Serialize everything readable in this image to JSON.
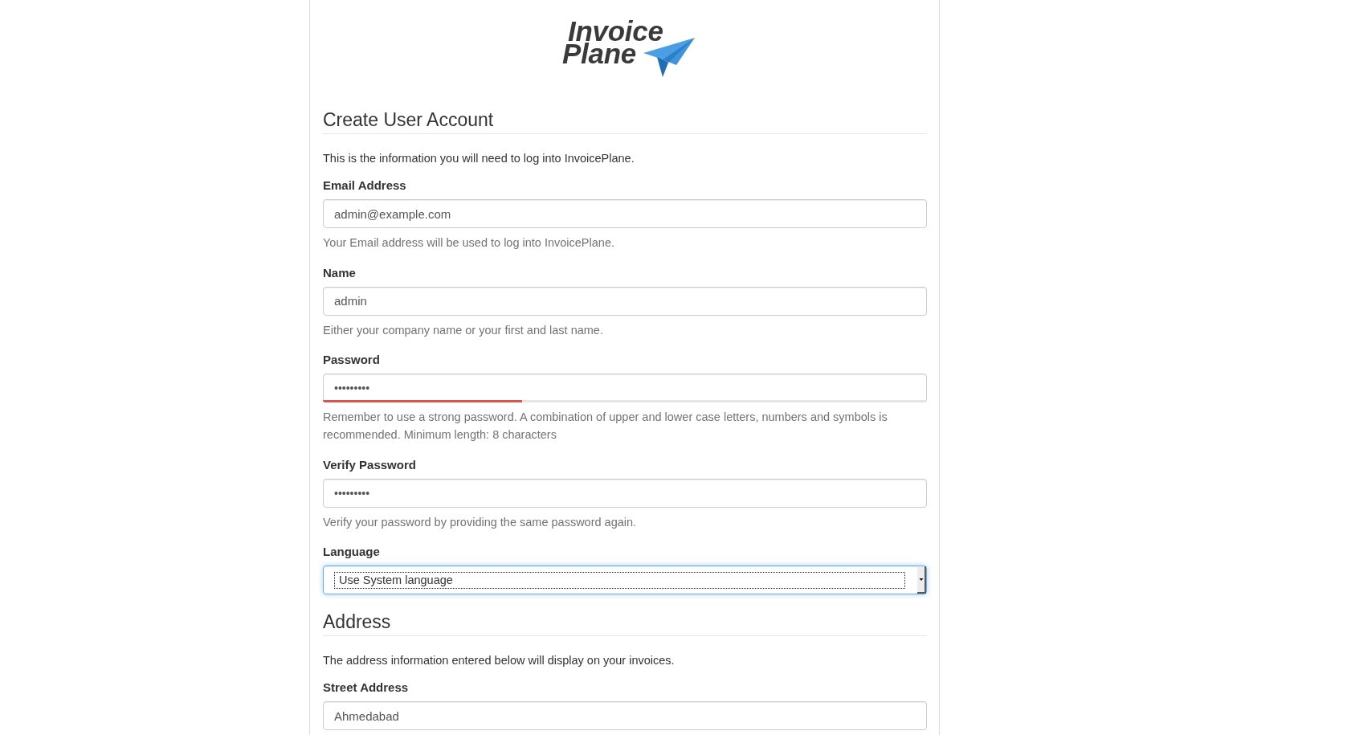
{
  "logo": {
    "lines": [
      "Invoice",
      "Plane"
    ]
  },
  "sections": [
    {
      "title": "Create User Account",
      "intro": "This is the information you will need to log into InvoicePlane.",
      "fields": [
        {
          "kind": "text",
          "label": "Email Address",
          "value": "admin@example.com",
          "focused": false,
          "help": "Your Email address will be used to log into InvoicePlane."
        },
        {
          "kind": "text",
          "label": "Name",
          "value": "admin",
          "focused": false,
          "help": "Either your company name or your first and last name."
        },
        {
          "kind": "password",
          "label": "Password",
          "value": "•••••••••",
          "focused": false,
          "strength": {
            "level": 0.33
          },
          "help": "Remember to use a strong password. A combination of upper and lower case letters, numbers and symbols is recommended. Minimum length: 8 characters"
        },
        {
          "kind": "password",
          "label": "Verify Password",
          "value": "•••••••••",
          "focused": false,
          "help": "Verify your password by providing the same password again."
        },
        {
          "kind": "select",
          "label": "Language",
          "value": "Use System language",
          "focused": true
        }
      ]
    },
    {
      "title": "Address",
      "intro": "The address information entered below will display on your invoices.",
      "fields": [
        {
          "kind": "text",
          "label": "Street Address",
          "value": "Ahmedabad",
          "focused": false
        }
      ]
    }
  ]
}
